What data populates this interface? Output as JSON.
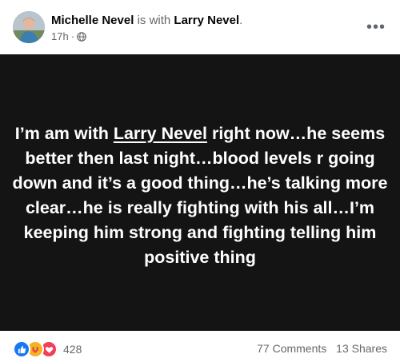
{
  "post": {
    "author": "Michelle Nevel",
    "with_text": "is with",
    "tagged": "Larry Nevel",
    "tagged_suffix": ".",
    "time": "17h",
    "separator": "·",
    "audience_icon": "globe-icon",
    "more_label": "•••"
  },
  "content": {
    "before_mention": "I’m am with ",
    "mention": "Larry Nevel",
    "after_mention": " right now…he seems better then last night…blood levels r going down and it’s a good thing…he’s talking more clear…he is really fighting with his all…I’m keeping him strong and fighting telling him positive thing",
    "background_color": "#141414"
  },
  "engagement": {
    "reaction_icons": [
      "like-icon",
      "care-icon",
      "love-icon"
    ],
    "reaction_count": "428",
    "comments": "77 Comments",
    "shares": "13 Shares"
  },
  "colors": {
    "like": "#1877f2",
    "care": "#f7b125",
    "love": "#f33e58",
    "secondary_text": "#65676b"
  }
}
